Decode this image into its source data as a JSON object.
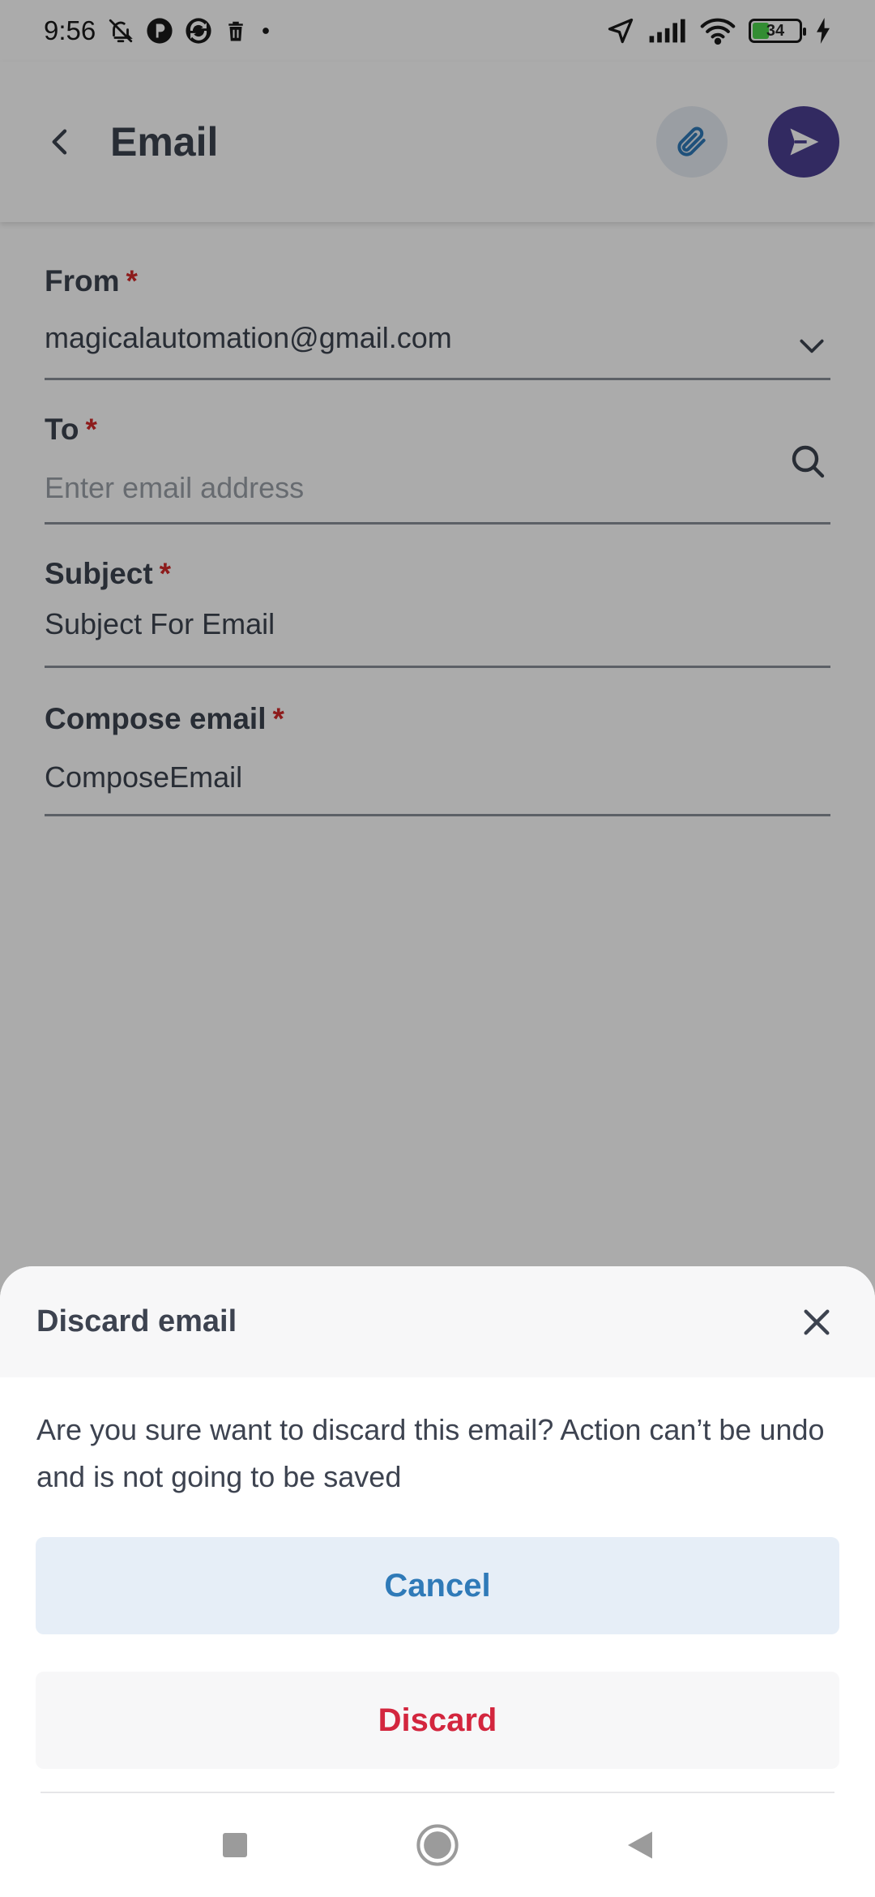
{
  "status_bar": {
    "time": "9:56",
    "battery_level": "34",
    "battery_fraction": 0.34,
    "left_icons": [
      "bell-off-icon",
      "app-icon-p",
      "sync-icon",
      "trash-icon",
      "dot-icon"
    ],
    "right_icons": [
      "navigation-icon",
      "signal-icon",
      "wifi-icon",
      "battery-icon",
      "charging-icon"
    ]
  },
  "app_bar": {
    "title": "Email",
    "back_icon": "chevron-left-icon",
    "attach_icon": "paperclip-icon",
    "send_icon": "send-icon"
  },
  "form": {
    "from": {
      "label": "From",
      "required_mark": "*",
      "value": "magicalautomation@gmail.com",
      "trailing_icon": "chevron-down-icon"
    },
    "to": {
      "label": "To",
      "required_mark": "*",
      "placeholder": "Enter email address",
      "trailing_icon": "search-icon"
    },
    "subject": {
      "label": "Subject",
      "required_mark": "*",
      "value": "Subject For Email"
    },
    "compose": {
      "label": "Compose email",
      "required_mark": "*",
      "value": "ComposeEmail"
    }
  },
  "dialog": {
    "title": "Discard email",
    "close_icon": "close-icon",
    "message": "Are you sure want to discard this email? Action can’t be undo and is not going to be saved",
    "cancel_label": "Cancel",
    "discard_label": "Discard"
  },
  "nav_bar": {
    "icons": [
      "recents-square-icon",
      "home-circle-icon",
      "back-triangle-icon"
    ]
  },
  "colors": {
    "accent": "#4b3f91",
    "required": "#d32a2a",
    "cancel_text": "#2f7ab8",
    "discard_text": "#d3263e",
    "battery_fill": "#4cd34c"
  }
}
